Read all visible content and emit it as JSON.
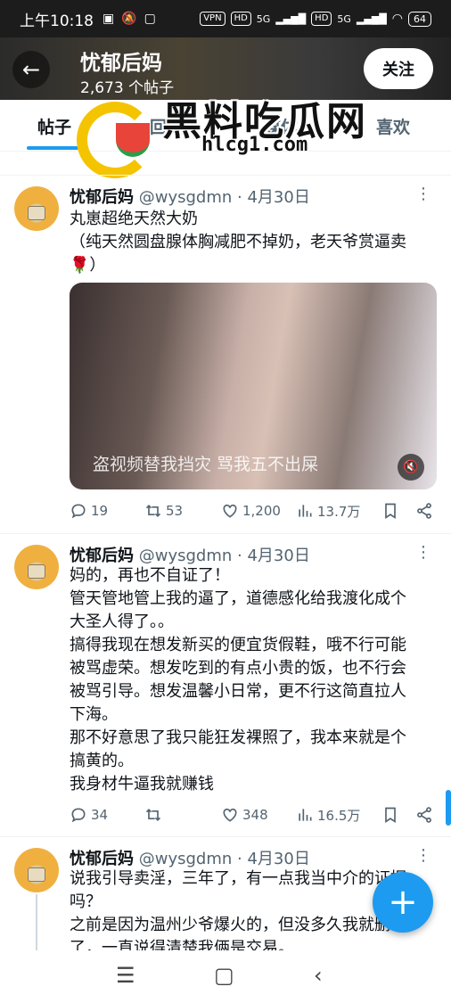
{
  "status_bar": {
    "time": "上午10:18",
    "network_pills": [
      "VPN",
      "HD",
      "HD"
    ],
    "signal_labels": [
      "5G",
      "5G"
    ],
    "battery": "64"
  },
  "header": {
    "title": "忧郁后妈",
    "subtitle": "2,673 个帖子",
    "follow_label": "关注"
  },
  "tabs": [
    {
      "label": "帖子",
      "active": true
    },
    {
      "label": "回复",
      "active": false
    },
    {
      "label": "媒体",
      "active": false
    },
    {
      "label": "喜欢",
      "active": false
    }
  ],
  "watermark": {
    "title": "黑料吃瓜网",
    "url": "hlcg1.com"
  },
  "posts": [
    {
      "name": "忧郁后妈",
      "handle": "@wysgdmn",
      "sep": "·",
      "date": "4月30日",
      "text": [
        "丸崽超绝天然大奶",
        "（纯天然圆盘腺体胸减肥不掉奶，老天爷赏逼卖",
        "🌹）"
      ],
      "media_caption": "盗视频替我挡灾 骂我五不出屎",
      "replies": "19",
      "retweets": "53",
      "likes": "1,200",
      "views": "13.7万"
    },
    {
      "name": "忧郁后妈",
      "handle": "@wysgdmn",
      "sep": "·",
      "date": "4月30日",
      "text": [
        "妈的，再也不自证了！",
        "管天管地管上我的逼了，道德感化给我渡化成个",
        "大圣人得了。。",
        "搞得我现在想发新买的便宜货假鞋，哦不行可能",
        "被骂虚荣。想发吃到的有点小贵的饭，也不行会",
        "被骂引导。想发温馨小日常，更不行这简直拉人",
        "下海。",
        "那不好意思了我只能狂发裸照了，我本来就是个",
        "搞黄的。",
        "我身材牛逼我就赚钱"
      ],
      "replies": "34",
      "retweets": "",
      "likes": "348",
      "views": "16.5万"
    },
    {
      "name": "忧郁后妈",
      "handle": "@wysgdmn",
      "sep": "·",
      "date": "4月30日",
      "text": [
        "说我引导卖淫，三年了，有一点我当中介的证据",
        "吗？",
        "之前是因为温州少爷爆火的，但没多久我就删",
        "了，一直说得清楚我俩是交易。"
      ]
    }
  ],
  "fab_label": "+",
  "colors": {
    "accent": "#1d9bf0",
    "text": "#0f1419",
    "muted": "#536471"
  }
}
